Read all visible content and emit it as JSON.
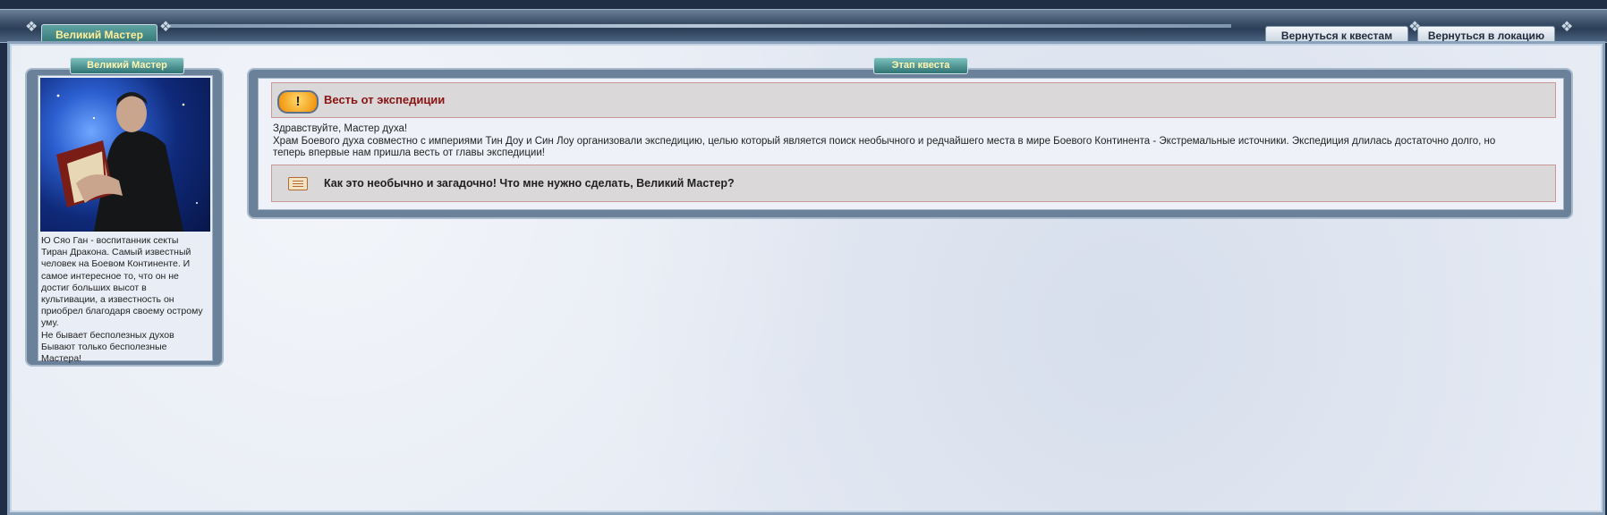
{
  "header": {
    "title": "Великий Мастер",
    "nav": {
      "back_quests": "Вернуться к квестам",
      "back_location": "Вернуться в локацию"
    }
  },
  "npc": {
    "title": "Великий Мастер",
    "description": [
      "Ю Сяо Ган - воспитанник секты",
      "Тиран Дракона. Самый известный",
      "человек на Боевом Континенте. И",
      "самое интересное то, что он не",
      "достиг больших высот в",
      "культивации, а известность он",
      "приобрел благодаря своему острому",
      "уму.",
      "Не бывает бесполезных духов",
      "Бывают только бесполезные",
      "Мастера!"
    ]
  },
  "quest": {
    "stage_label": "Этап квеста",
    "title": "Весть от экспедиции",
    "icon": "exclamation-badge-icon",
    "text": [
      "Здравствуйте, Мастер духа!",
      "Храм Боевого духа совместно с империями Тин Доу и Син Лоу организовали экспедицию, целью который является поиск необычного и редчайшего места в мире Боевого Континента - Экстремальные источники. Экспедиция длилась достаточно долго, но",
      "теперь впервые нам пришла весть от главы экспедиции!"
    ],
    "answer": {
      "icon": "scroll-icon",
      "text": "Как это необычно и загадочно! Что мне нужно сделать, Великий Мастер?"
    }
  },
  "colors": {
    "accent_teal": "#2f7474",
    "title_red": "#8a1212",
    "badge_orange": "#f08a00"
  }
}
